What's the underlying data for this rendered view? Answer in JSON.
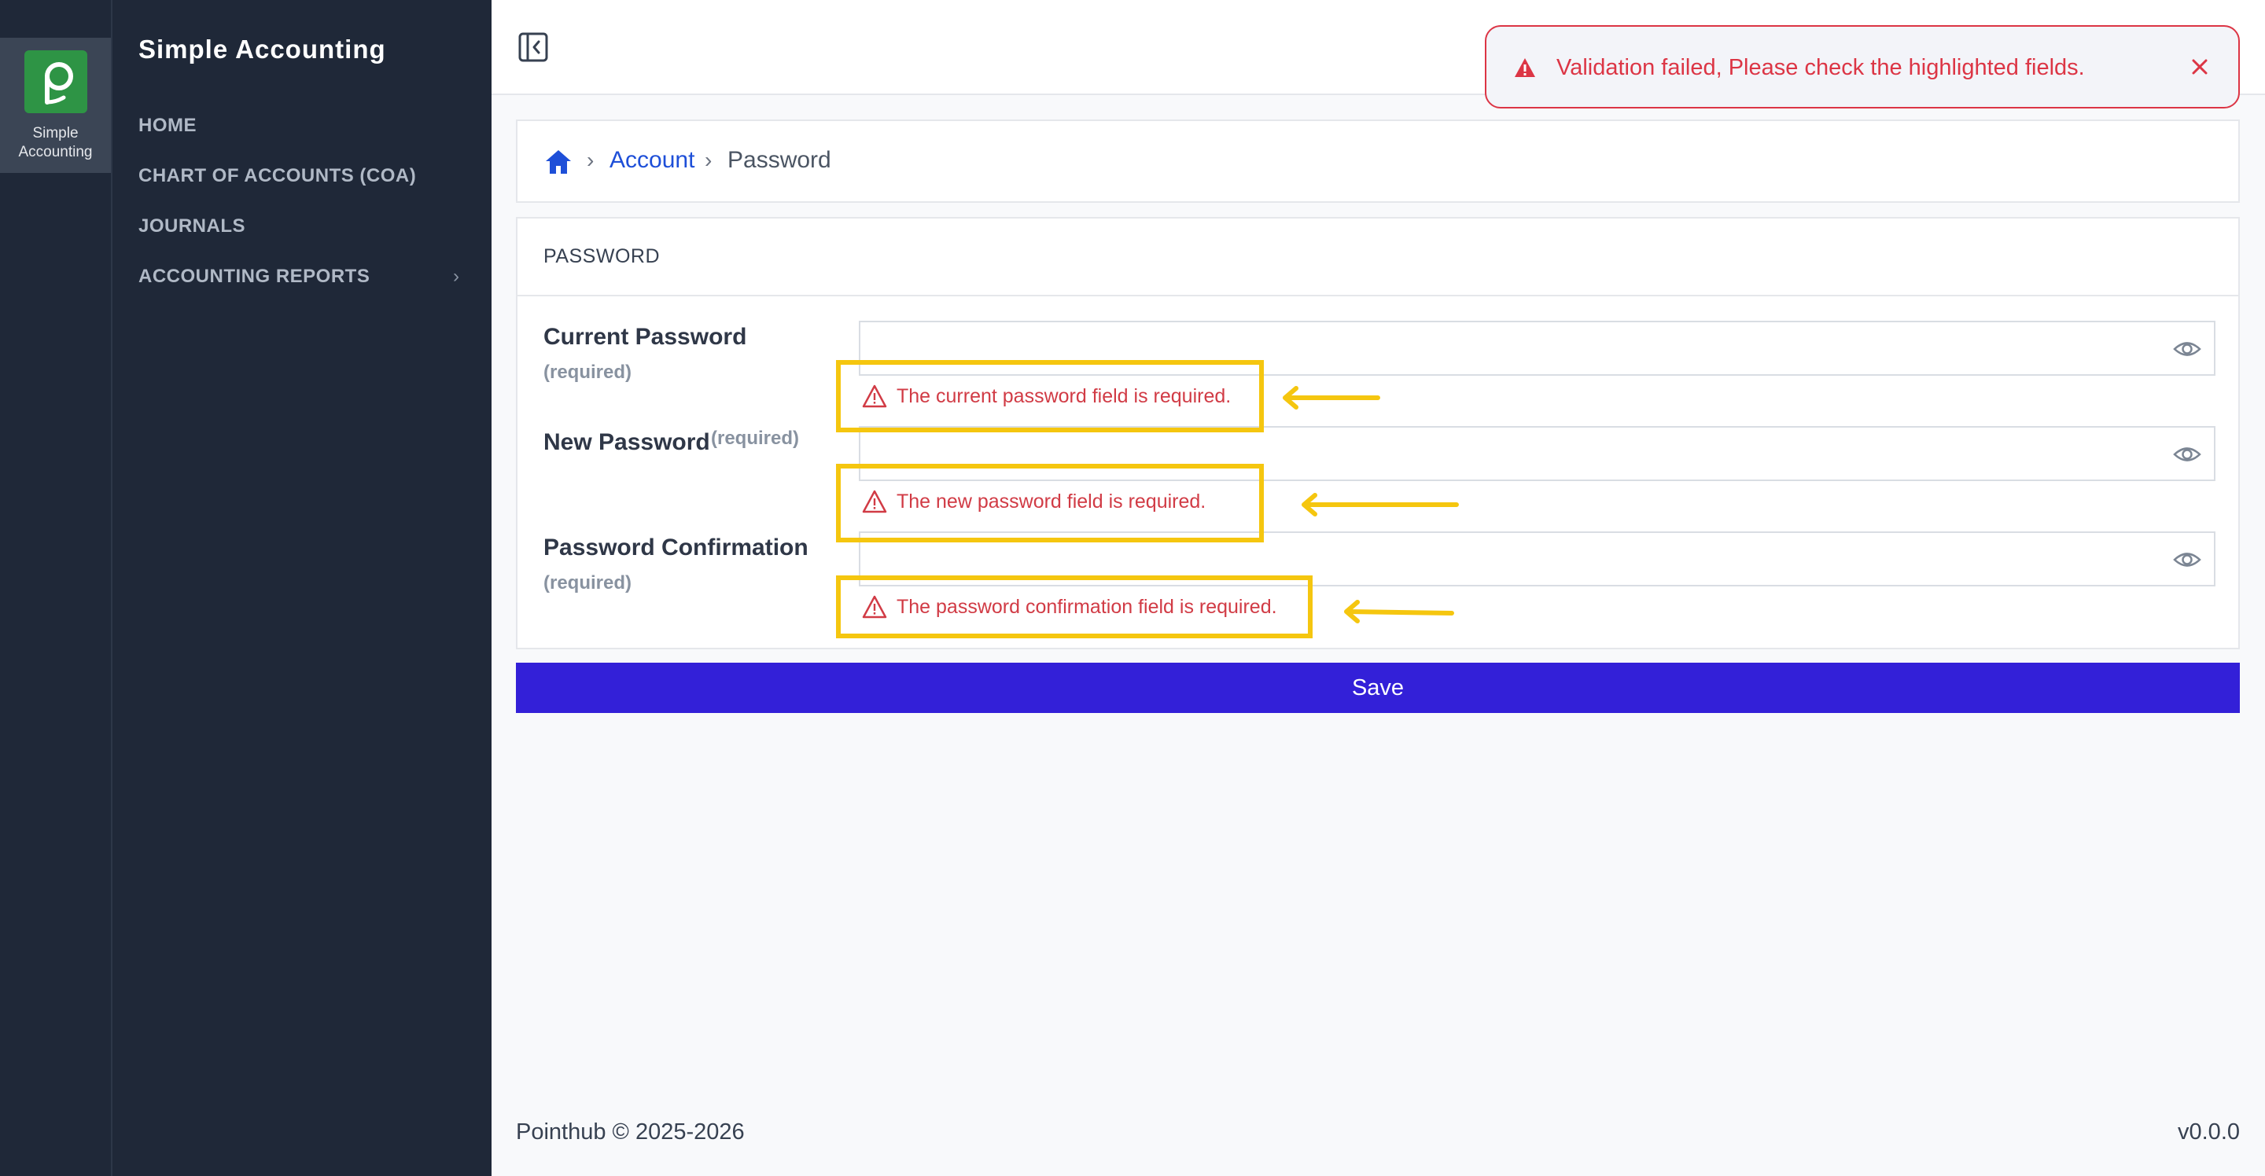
{
  "app": {
    "rail_label": "Simple Accounting",
    "nav_title": "Simple Accounting",
    "logo_color": "#2e9445"
  },
  "nav": {
    "items": [
      {
        "label": "HOME"
      },
      {
        "label": "CHART OF ACCOUNTS (COA)"
      },
      {
        "label": "JOURNALS"
      },
      {
        "label": "ACCOUNTING REPORTS",
        "has_submenu": true
      }
    ]
  },
  "header": {
    "collapse_icon": "sidebar-collapse-icon"
  },
  "toast": {
    "message": "Validation failed, Please check the highlighted fields.",
    "color": "#dc3545",
    "icon": "warning-icon",
    "close_icon": "close-icon"
  },
  "breadcrumb": {
    "home_icon": "home-icon",
    "items": [
      {
        "label": "Account",
        "link": true
      },
      {
        "label": "Password",
        "link": false
      }
    ]
  },
  "form": {
    "section_title": "PASSWORD",
    "fields": [
      {
        "label": "Current Password",
        "required_text": "(required)",
        "value": "",
        "error": "The current password field is required."
      },
      {
        "label": "New Password",
        "required_text": "(required)",
        "value": "",
        "error": "The new password field is required."
      },
      {
        "label": "Password Confirmation",
        "required_text": "(required)",
        "value": "",
        "error": "The password confirmation field is required."
      }
    ],
    "save_label": "Save",
    "save_color": "#3320d8",
    "error_color": "#d13b45",
    "highlight_color": "#f5c60f"
  },
  "footer": {
    "copyright": "Pointhub © 2025-2026",
    "version": "v0.0.0"
  }
}
